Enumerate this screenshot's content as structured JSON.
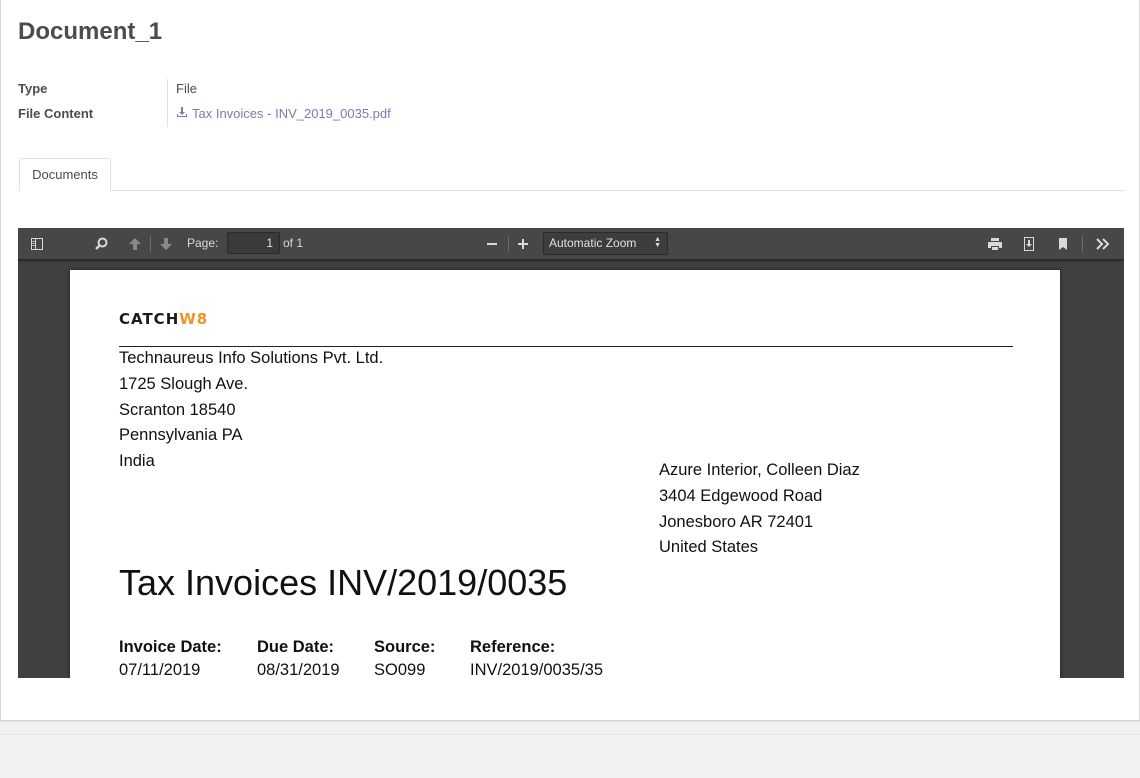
{
  "record": {
    "title": "Document_1",
    "fields": {
      "type_label": "Type",
      "type_value": "File",
      "file_content_label": "File Content",
      "file_name": "Tax Invoices - INV_2019_0035.pdf"
    },
    "tabs": [
      {
        "label": "Documents",
        "active": true
      }
    ]
  },
  "viewer": {
    "toolbar": {
      "page_label": "Page:",
      "page_current": "1",
      "page_total": "of 1",
      "zoom": "Automatic Zoom",
      "icons": [
        "sidebar-toggle-icon",
        "search-icon",
        "arrow-up-icon",
        "arrow-down-icon",
        "minus-icon",
        "plus-icon",
        "print-icon",
        "download-icon",
        "bookmark-icon",
        "double-chevron-right-icon"
      ]
    },
    "document": {
      "logo_part1": "CATCH",
      "logo_part2": "W8",
      "logo_accent_color": "#f0922b",
      "company": {
        "name": "Technaureus Info Solutions Pvt. Ltd.",
        "line1": "1725 Slough Ave.",
        "line2": "Scranton 18540",
        "line3": "Pennsylvania PA",
        "line4": "India"
      },
      "customer": {
        "name": "Azure Interior, Colleen Diaz",
        "line1": "3404 Edgewood Road",
        "line2": "Jonesboro AR 72401",
        "line3": "United States"
      },
      "invoice_title": "Tax Invoices INV/2019/0035",
      "meta": {
        "invoice_date_label": "Invoice Date:",
        "invoice_date": "07/11/2019",
        "due_date_label": "Due Date:",
        "due_date": "08/31/2019",
        "source_label": "Source:",
        "source": "SO099",
        "reference_label": "Reference:",
        "reference": "INV/2019/0035/35"
      }
    }
  }
}
